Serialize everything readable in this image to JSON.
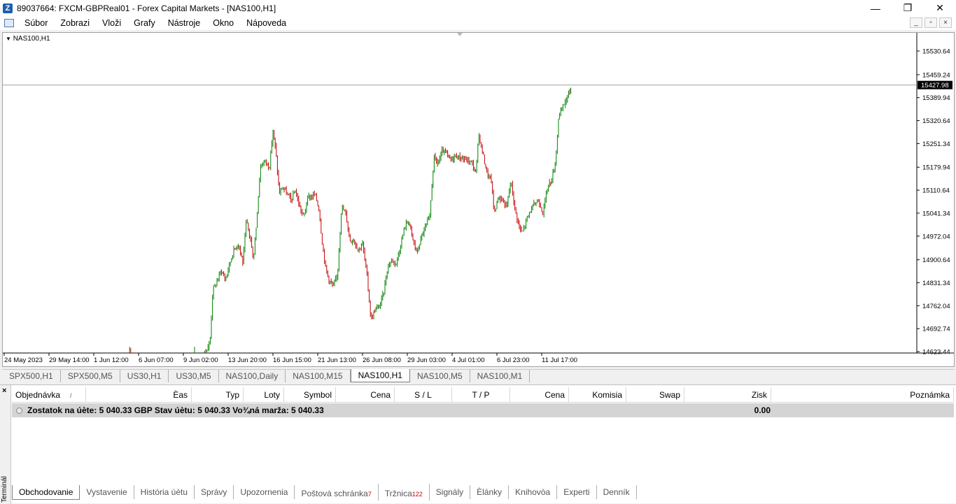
{
  "window": {
    "title": "89037664: FXCM-GBPReal01 - Forex Capital Markets - [NAS100,H1]",
    "minimize": "—",
    "maximize": "❐",
    "close": "✕"
  },
  "menu": [
    "Súbor",
    "Zobrazi",
    "Vloži",
    "Grafy",
    "Nástroje",
    "Okno",
    "Nápoveda"
  ],
  "chart": {
    "label": "NAS100,H1",
    "current_price": "15427.98"
  },
  "chart_data": {
    "type": "candlestick",
    "symbol": "NAS100",
    "timeframe": "H1",
    "y_ticks": [
      "15530.64",
      "15459.24",
      "15389.94",
      "15320.64",
      "15251.34",
      "15179.94",
      "15110.64",
      "15041.34",
      "14972.04",
      "14900.64",
      "14831.34",
      "14762.04",
      "14692.74",
      "14623.44"
    ],
    "y_tick_values": [
      15530.64,
      15459.24,
      15389.94,
      15320.64,
      15251.34,
      15179.94,
      15110.64,
      15041.34,
      14972.04,
      14900.64,
      14831.34,
      14762.04,
      14692.74,
      14623.44
    ],
    "x_ticks": [
      "24 May 2023",
      "29 May 14:00",
      "1 Jun 12:00",
      "6 Jun 07:00",
      "9 Jun 02:00",
      "13 Jun 20:00",
      "16 Jun 15:00",
      "21 Jun 13:00",
      "26 Jun 08:00",
      "29 Jun 03:00",
      "4 Jul 01:00",
      "6 Jul 23:00",
      "11 Jul 17:00"
    ],
    "ylim": [
      14623.44,
      15554
    ],
    "current_price": 15427.98,
    "trend": [
      [
        0,
        14500
      ],
      [
        178,
        14560
      ],
      [
        181,
        14640
      ],
      [
        185,
        14540
      ],
      [
        222,
        14560
      ],
      [
        226,
        14610
      ],
      [
        232,
        14540
      ],
      [
        268,
        14580
      ],
      [
        275,
        14640
      ],
      [
        283,
        14600
      ],
      [
        290,
        14625
      ],
      [
        296,
        14650
      ],
      [
        300,
        14810
      ],
      [
        305,
        14830
      ],
      [
        312,
        14870
      ],
      [
        318,
        14840
      ],
      [
        323,
        14880
      ],
      [
        330,
        14930
      ],
      [
        337,
        14950
      ],
      [
        343,
        14890
      ],
      [
        348,
        15020
      ],
      [
        354,
        14960
      ],
      [
        358,
        14900
      ],
      [
        362,
        15000
      ],
      [
        368,
        15180
      ],
      [
        374,
        15200
      ],
      [
        381,
        15180
      ],
      [
        386,
        15290
      ],
      [
        390,
        15230
      ],
      [
        395,
        15100
      ],
      [
        400,
        15120
      ],
      [
        406,
        15100
      ],
      [
        412,
        15080
      ],
      [
        418,
        15110
      ],
      [
        424,
        15060
      ],
      [
        430,
        15030
      ],
      [
        436,
        15090
      ],
      [
        441,
        15090
      ],
      [
        446,
        15100
      ],
      [
        452,
        15050
      ],
      [
        456,
        14960
      ],
      [
        461,
        14880
      ],
      [
        466,
        14840
      ],
      [
        472,
        14820
      ],
      [
        478,
        14850
      ],
      [
        484,
        15060
      ],
      [
        490,
        15040
      ],
      [
        496,
        14960
      ],
      [
        502,
        14960
      ],
      [
        508,
        14930
      ],
      [
        514,
        14950
      ],
      [
        520,
        14860
      ],
      [
        526,
        14720
      ],
      [
        532,
        14750
      ],
      [
        538,
        14760
      ],
      [
        544,
        14800
      ],
      [
        550,
        14880
      ],
      [
        556,
        14900
      ],
      [
        562,
        14890
      ],
      [
        568,
        14940
      ],
      [
        574,
        15000
      ],
      [
        580,
        15020
      ],
      [
        586,
        14960
      ],
      [
        592,
        14920
      ],
      [
        598,
        14970
      ],
      [
        604,
        15000
      ],
      [
        610,
        15030
      ],
      [
        616,
        15210
      ],
      [
        622,
        15190
      ],
      [
        628,
        15230
      ],
      [
        634,
        15220
      ],
      [
        640,
        15200
      ],
      [
        646,
        15215
      ],
      [
        652,
        15210
      ],
      [
        658,
        15205
      ],
      [
        664,
        15200
      ],
      [
        670,
        15195
      ],
      [
        676,
        15160
      ],
      [
        680,
        15280
      ],
      [
        686,
        15220
      ],
      [
        692,
        15160
      ],
      [
        698,
        15140
      ],
      [
        702,
        15040
      ],
      [
        708,
        15090
      ],
      [
        714,
        15080
      ],
      [
        720,
        15060
      ],
      [
        726,
        15140
      ],
      [
        732,
        15050
      ],
      [
        738,
        15000
      ],
      [
        742,
        14980
      ],
      [
        748,
        15020
      ],
      [
        754,
        15050
      ],
      [
        760,
        15070
      ],
      [
        766,
        15080
      ],
      [
        772,
        15040
      ],
      [
        778,
        15120
      ],
      [
        784,
        15140
      ],
      [
        790,
        15200
      ],
      [
        794,
        15330
      ],
      [
        798,
        15350
      ],
      [
        804,
        15380
      ],
      [
        810,
        15410
      ],
      [
        813,
        15427.98
      ]
    ]
  },
  "symbol_tabs": [
    "SPX500,H1",
    "SPX500,M5",
    "US30,H1",
    "US30,M5",
    "NAS100,Daily",
    "NAS100,M15",
    "NAS100,H1",
    "NAS100,M5",
    "NAS100,M1"
  ],
  "active_symbol_tab": "NAS100,H1",
  "terminal": {
    "close_label": "×",
    "side_label": "Terminál",
    "columns": [
      "Objednávka",
      "Èas",
      "Typ",
      "Loty",
      "Symbol",
      "Cena",
      "S / L",
      "T / P",
      "Cena",
      "Komisia",
      "Swap",
      "Zisk",
      "Poznámka"
    ],
    "sort_indicator": "/",
    "balance_text": "Zostatok na úète: 5 040.33 GBP  Stav úètu: 5 040.33  Vo¾ná marža: 5 040.33",
    "profit": "0.00",
    "bottom_tabs": [
      {
        "label": "Obchodovanie",
        "badge": ""
      },
      {
        "label": "Vystavenie",
        "badge": ""
      },
      {
        "label": "História úètu",
        "badge": ""
      },
      {
        "label": "Správy",
        "badge": ""
      },
      {
        "label": "Upozornenia",
        "badge": ""
      },
      {
        "label": "Poštová schránka",
        "badge": "7"
      },
      {
        "label": "Tržnica",
        "badge": "122"
      },
      {
        "label": "Signály",
        "badge": ""
      },
      {
        "label": "Èlánky",
        "badge": ""
      },
      {
        "label": "Knihovòa",
        "badge": ""
      },
      {
        "label": "Experti",
        "badge": ""
      },
      {
        "label": "Denník",
        "badge": ""
      }
    ],
    "active_bottom_tab": "Obchodovanie"
  },
  "colors": {
    "bull": "#008000",
    "bear": "#c00000",
    "price_label_bg": "#000000"
  }
}
